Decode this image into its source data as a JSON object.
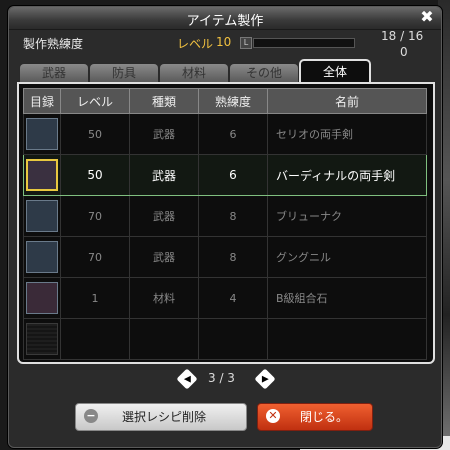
{
  "window": {
    "title": "アイテム製作"
  },
  "skill": {
    "label": "製作熟練度",
    "level_label": "レベル",
    "level": "10",
    "exp_progress": 0.0
  },
  "counter": {
    "line1": "18 / 16",
    "line2": "0"
  },
  "tabs": [
    {
      "label": "武器",
      "active": false
    },
    {
      "label": "防具",
      "active": false
    },
    {
      "label": "材料",
      "active": false
    },
    {
      "label": "その他",
      "active": false
    },
    {
      "label": "全体",
      "active": true
    }
  ],
  "table": {
    "headers": [
      "目録",
      "レベル",
      "種類",
      "熟練度",
      "名前"
    ],
    "rows": [
      {
        "icon": "dark-sword-icon",
        "level": "50",
        "type": "武器",
        "skill": "6",
        "name": "セリオの両手剣",
        "selected": false
      },
      {
        "icon": "ornate-sword-icon",
        "level": "50",
        "type": "武器",
        "skill": "6",
        "name": "バーディナルの両手剣",
        "selected": true
      },
      {
        "icon": "spear-icon",
        "level": "70",
        "type": "武器",
        "skill": "8",
        "name": "ブリューナク",
        "selected": false
      },
      {
        "icon": "spear-icon",
        "level": "70",
        "type": "武器",
        "skill": "8",
        "name": "グングニル",
        "selected": false
      },
      {
        "icon": "ore-icon",
        "level": "1",
        "type": "材料",
        "skill": "4",
        "name": "B級組合石",
        "selected": false
      }
    ]
  },
  "pager": {
    "text": "3 / 3"
  },
  "buttons": {
    "remove": "選択レシピ削除",
    "close": "閉じる。"
  }
}
